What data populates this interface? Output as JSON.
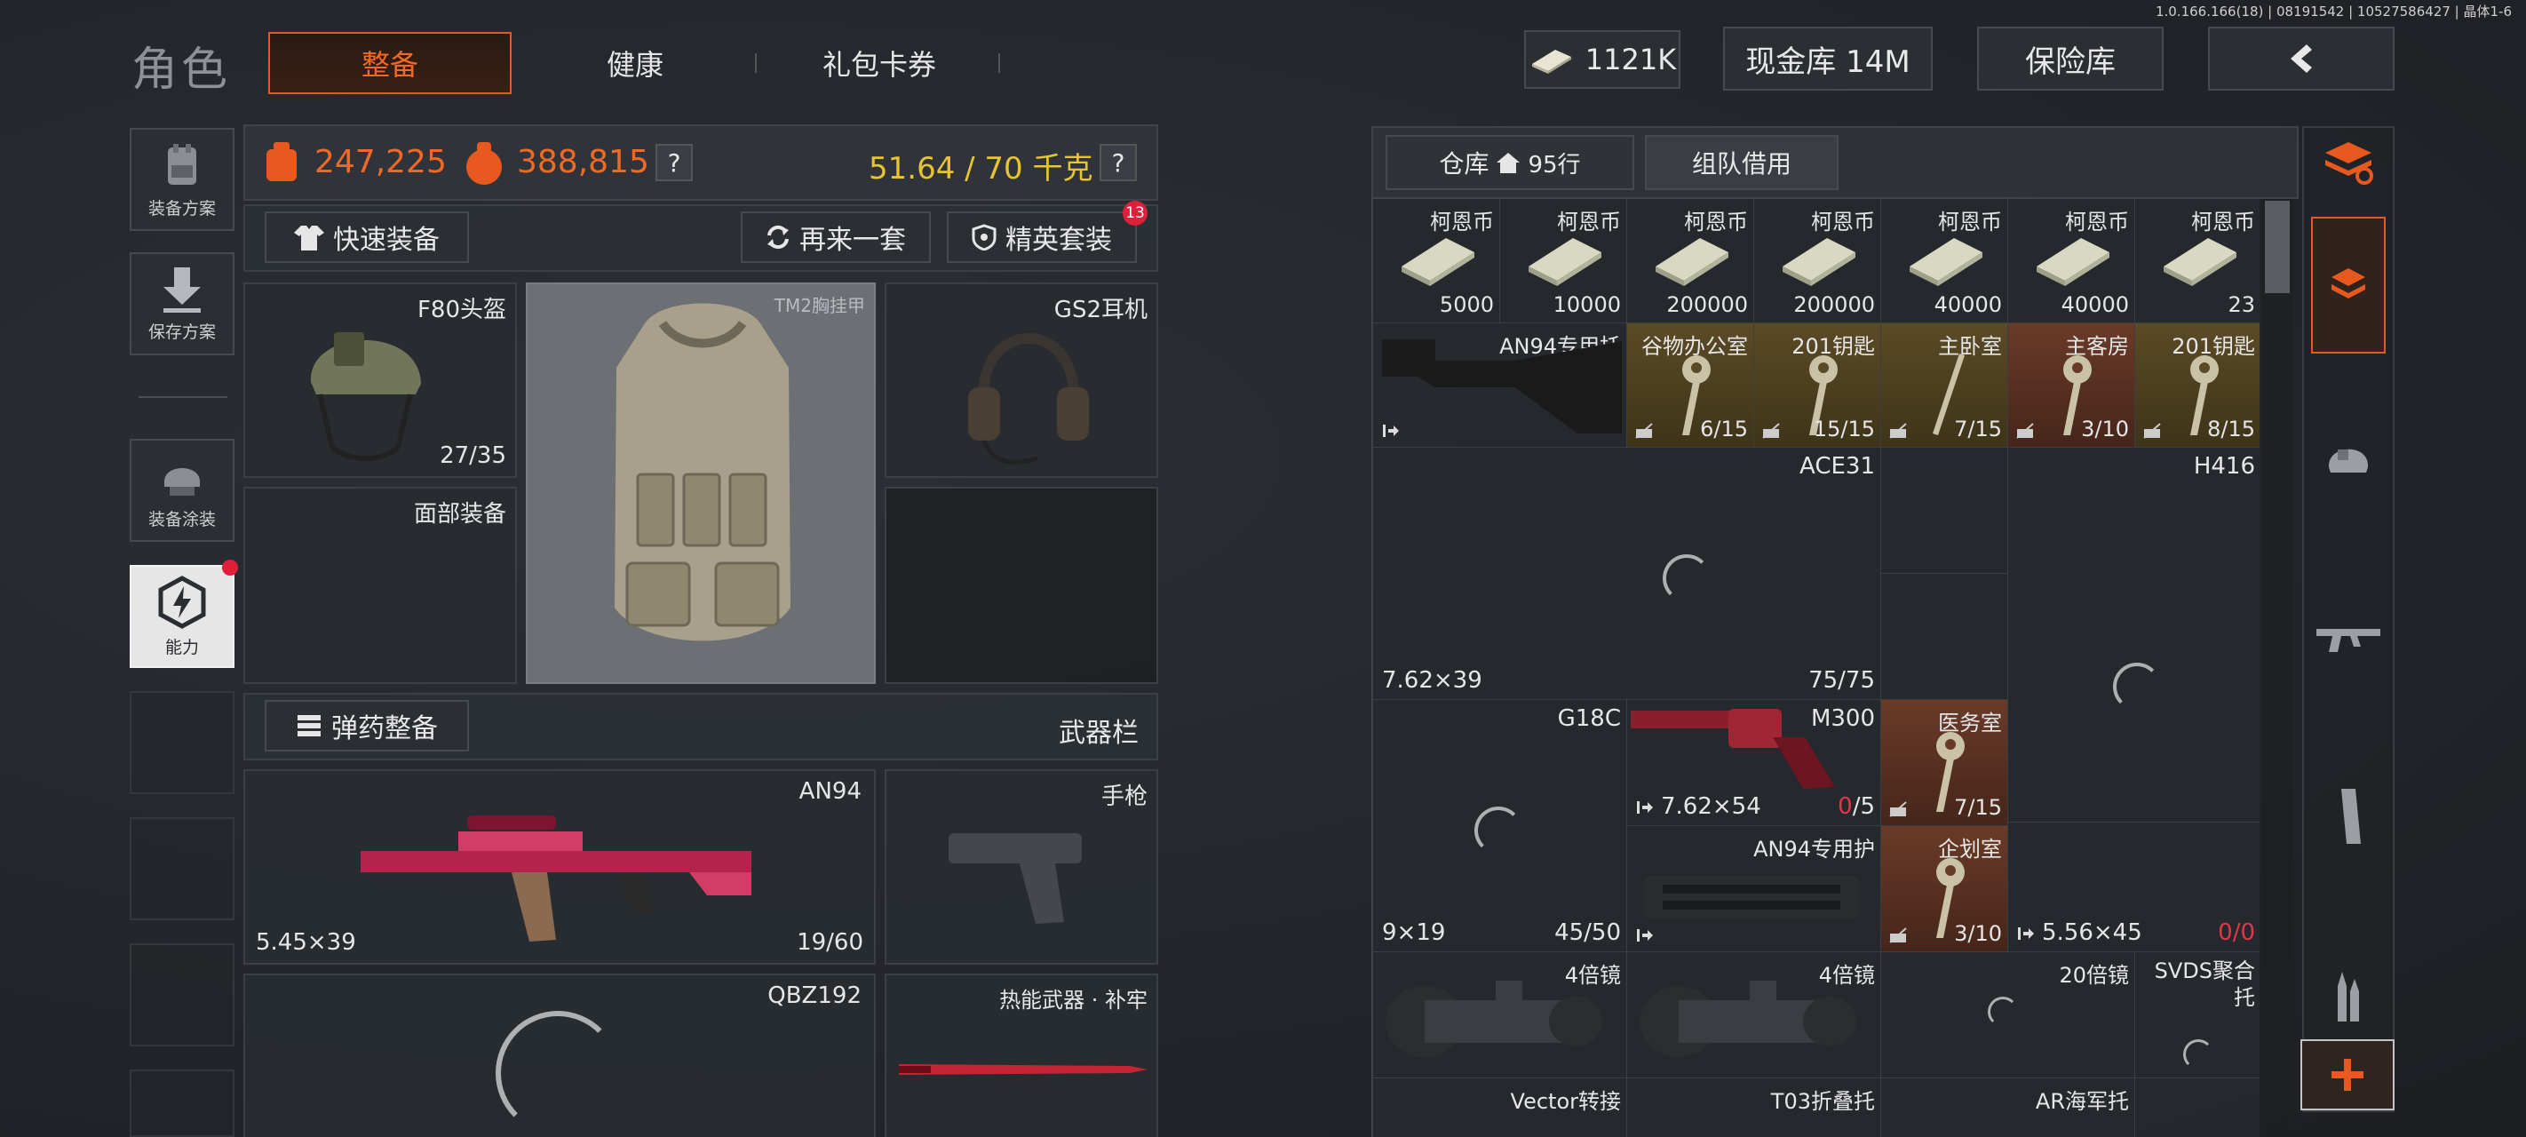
{
  "version_info": "1.0.166.166(18) | 08191542 | 10527586427 | 晶体1-6",
  "header": {
    "title": "角色",
    "tabs": [
      {
        "label": "整备",
        "active": true
      },
      {
        "label": "健康",
        "active": false
      },
      {
        "label": "礼包卡券",
        "active": false
      }
    ],
    "currency": "1121K",
    "cash_vault": "现金库 14M",
    "safe_box": "保险库"
  },
  "sidebar": {
    "items": [
      {
        "label": "装备方案",
        "icon": "vest-icon"
      },
      {
        "label": "保存方案",
        "icon": "download-icon"
      },
      {
        "label": "装备涂装",
        "icon": "helmet-paint-icon"
      },
      {
        "label": "能力",
        "icon": "ability-icon"
      }
    ]
  },
  "stats": {
    "value1": "247,225",
    "value2": "388,815",
    "weight": "51.64 / 70 千克",
    "help": "?"
  },
  "actions": {
    "quick_equip": "快速装备",
    "again": "再来一套",
    "elite_set": "精英套装",
    "elite_badge": "13",
    "ammo_equip": "弹药整备",
    "weapon_bar": "武器栏"
  },
  "equipment": {
    "helmet": {
      "name": "F80头盔",
      "durability": "27/35"
    },
    "armor": {
      "name": "TM2胸挂甲"
    },
    "headset": {
      "name": "GS2耳机"
    },
    "face": {
      "name": "面部装备"
    },
    "primary": {
      "name": "AN94",
      "caliber": "5.45×39",
      "ammo": "19/60"
    },
    "pistol": {
      "name": "手枪"
    },
    "secondary": {
      "name": "QBZ192"
    },
    "melee": {
      "name": "热能武器 · 补牢"
    }
  },
  "warehouse": {
    "tab": "仓库",
    "rows": "95行",
    "team_tab": "组队借用",
    "coins": [
      {
        "label": "柯恩币",
        "amount": "5000"
      },
      {
        "label": "柯恩币",
        "amount": "10000"
      },
      {
        "label": "柯恩币",
        "amount": "200000"
      },
      {
        "label": "柯恩币",
        "amount": "200000"
      },
      {
        "label": "柯恩币",
        "amount": "40000"
      },
      {
        "label": "柯恩币",
        "amount": "40000"
      },
      {
        "label": "柯恩币",
        "amount": "23"
      }
    ],
    "row2": {
      "stock": "AN94专用托",
      "keys": [
        {
          "label": "谷物办公室",
          "count": "6/15",
          "tone": "gold"
        },
        {
          "label": "201钥匙",
          "count": "15/15",
          "tone": "gold"
        },
        {
          "label": "主卧室",
          "count": "7/15",
          "tone": "gold"
        },
        {
          "label": "主客房",
          "count": "3/10",
          "tone": "red"
        },
        {
          "label": "201钥匙",
          "count": "8/15",
          "tone": "gold"
        }
      ]
    },
    "row3": {
      "caliber": "7.62×39",
      "ace": "ACE31",
      "ace_ammo": "75/75",
      "h416": "H416"
    },
    "row4": {
      "g18c": "G18C",
      "g18c_caliber": "9×19",
      "g18c_ammo": "45/50",
      "m300": "M300",
      "m300_caliber": "7.62×54",
      "m300_ammo_current": "0",
      "m300_ammo_max": "/5",
      "med_key": "医务室",
      "med_count": "7/15",
      "handguard": "AN94专用护",
      "plan_key": "企划室",
      "plan_count": "3/10",
      "right_caliber": "5.56×45",
      "right_ammo_current": "0",
      "right_ammo_max": "/0"
    },
    "row5": {
      "scope1": "4倍镜",
      "scope2": "4倍镜",
      "scope3": "20倍镜",
      "svds": "SVDS聚合托"
    },
    "row6": {
      "vector": "Vector转接",
      "t03": "T03折叠托",
      "ar": "AR海军托"
    }
  },
  "colors": {
    "accent_orange": "#e8591f",
    "gold": "#e8c332",
    "value_orange": "#f06a26",
    "red_ammo": "#e0364a"
  }
}
